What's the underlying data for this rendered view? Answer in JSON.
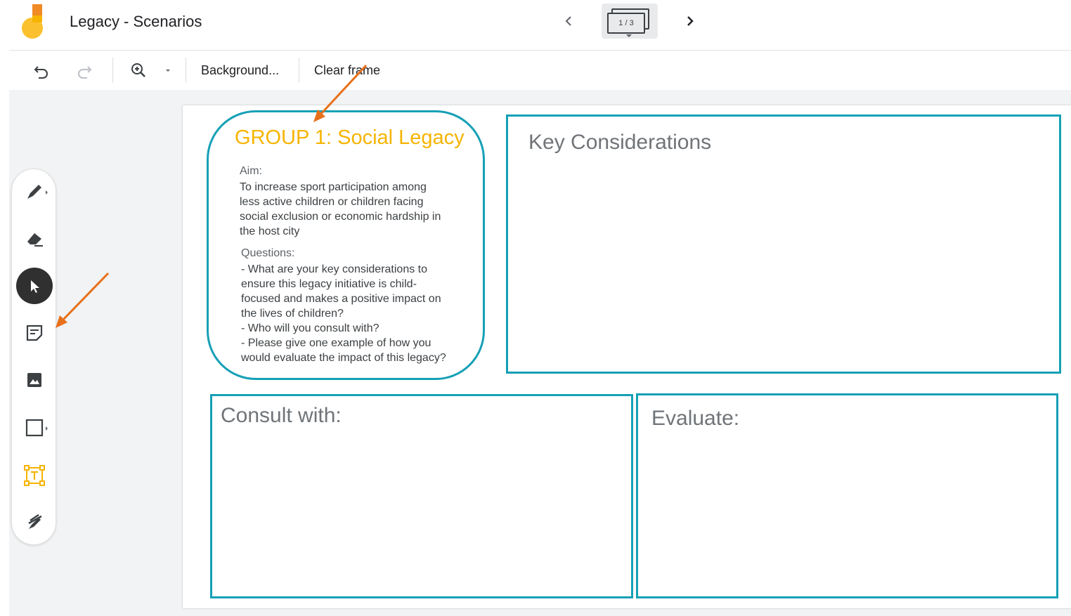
{
  "header": {
    "app_title": "Legacy - Scenarios",
    "frame_indicator": "1 / 3",
    "prev_icon": "chevron-left-icon",
    "next_icon": "chevron-right-icon"
  },
  "toolbar": {
    "undo_icon": "undo-icon",
    "redo_icon": "redo-icon",
    "zoom_icon": "zoom-in-icon",
    "background_label": "Background...",
    "clear_frame_label": "Clear frame"
  },
  "tools": [
    {
      "name": "pen",
      "icon": "pen-icon"
    },
    {
      "name": "eraser",
      "icon": "eraser-icon"
    },
    {
      "name": "select",
      "icon": "cursor-icon",
      "active": true
    },
    {
      "name": "sticky-note",
      "icon": "sticky-note-icon"
    },
    {
      "name": "image",
      "icon": "image-icon"
    },
    {
      "name": "shape",
      "icon": "square-icon"
    },
    {
      "name": "text-box",
      "icon": "text-box-icon"
    },
    {
      "name": "laser",
      "icon": "laser-icon"
    }
  ],
  "frame": {
    "group_title": "GROUP 1: Social Legacy",
    "aim_label": "Aim:",
    "aim_lines": [
      "To increase sport participation among",
      "less active children or children facing",
      "social exclusion or economic hardship in",
      "the host city"
    ],
    "questions_label": "Questions:",
    "question_lines": [
      "- What are your key considerations to",
      "ensure this legacy initiative is child-",
      "focused and makes a positive impact on",
      "the lives of children?",
      "- Who will you consult with?",
      "- Please give one example of how you",
      "would evaluate the impact of this legacy?"
    ],
    "key_considerations_title": "Key Considerations",
    "consult_title": "Consult with:",
    "evaluate_title": "Evaluate:"
  },
  "colors": {
    "accent_teal": "#16a0b6",
    "group_title_yellow": "#f6b400",
    "annotation_arrow": "#e8701a"
  }
}
